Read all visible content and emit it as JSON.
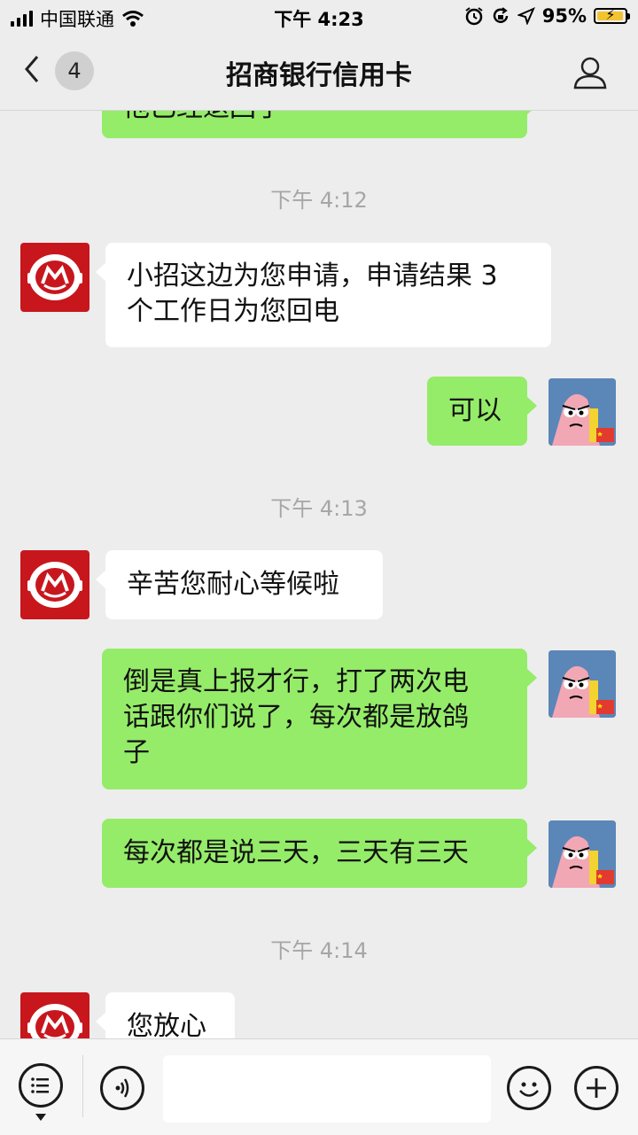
{
  "status_bar": {
    "carrier": "中国联通",
    "time": "下午 4:23",
    "battery": "95%",
    "battery_level": 0.95,
    "icons": [
      "signal-icon",
      "wifi-icon",
      "alarm-icon",
      "rotation-lock-icon",
      "location-icon",
      "battery-icon"
    ]
  },
  "nav": {
    "back_icon": "chevron-left-icon",
    "unread_count": "4",
    "title": "招商银行信用卡",
    "profile_icon": "person-icon"
  },
  "messages": {
    "partial_top": "他已经退回了",
    "t1": "下午 4:12",
    "m1": "小招这边为您申请，申请结果 3",
    "m1b": "个工作日为您回电",
    "m2": "可以",
    "t2": "下午 4:13",
    "m3": "辛苦您耐心等候啦",
    "m4a": "倒是真上报才行，打了两次电",
    "m4b": "话跟你们说了，每次都是放鸽",
    "m4c": "子",
    "m5": "每次都是说三天，三天有三天",
    "t3": "下午 4:14",
    "m6": "您放心"
  },
  "input_bar": {
    "menu_icon": "menu-list-icon",
    "voice_icon": "voice-icon",
    "message_value": "",
    "emoji_icon": "emoji-icon",
    "plus_icon": "plus-icon"
  },
  "colors": {
    "background": "#ededed",
    "sent_bubble": "#95ec69",
    "received_bubble": "#ffffff",
    "bank_red": "#c8161d"
  }
}
